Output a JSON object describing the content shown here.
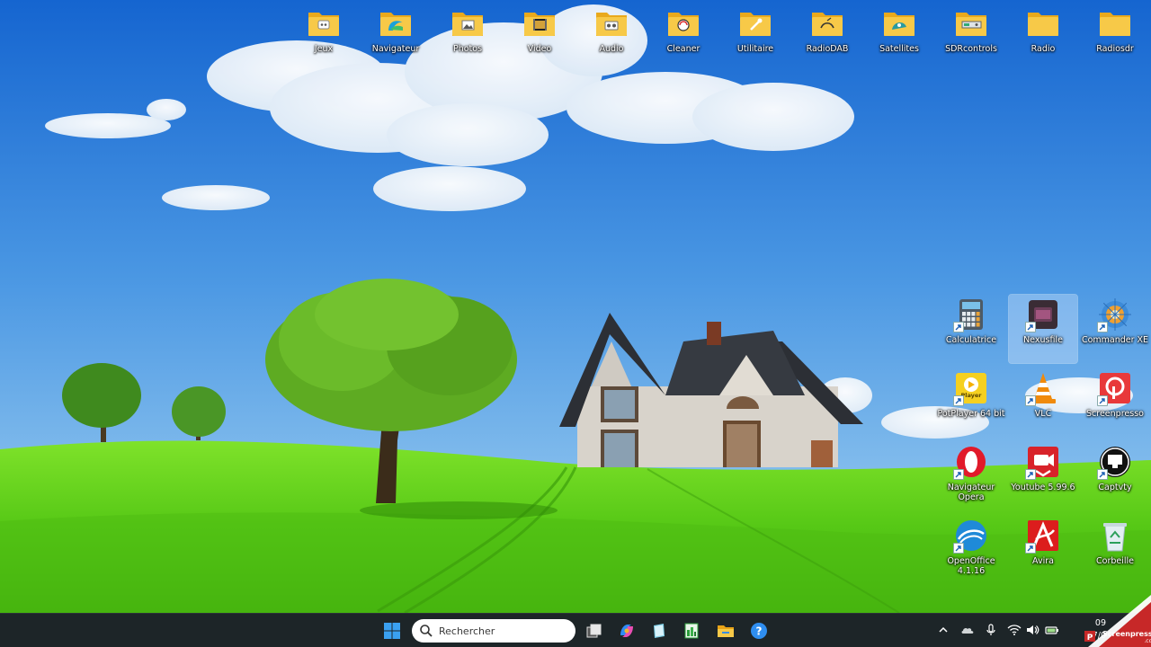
{
  "desktop": {
    "top_row": [
      {
        "name": "jeux",
        "label": "Jeux",
        "icon": "folder-games-icon"
      },
      {
        "name": "navigateur",
        "label": "Navigateur",
        "icon": "folder-browser-icon"
      },
      {
        "name": "photos",
        "label": "Photos",
        "icon": "folder-photos-icon"
      },
      {
        "name": "video",
        "label": "Video",
        "icon": "folder-video-icon"
      },
      {
        "name": "audio",
        "label": "Audio",
        "icon": "folder-audio-icon"
      },
      {
        "name": "cleaner",
        "label": "Cleaner",
        "icon": "folder-cleaner-icon"
      },
      {
        "name": "utilitaire",
        "label": "Utilitaire",
        "icon": "folder-utility-icon"
      },
      {
        "name": "radiodab",
        "label": "RadioDAB",
        "icon": "folder-radio-dab-icon"
      },
      {
        "name": "satellites",
        "label": "Satellites",
        "icon": "folder-satellites-icon"
      },
      {
        "name": "sdrcontrols",
        "label": "SDRcontrols",
        "icon": "folder-sdr-icon"
      },
      {
        "name": "radio",
        "label": "Radio",
        "icon": "folder-icon"
      },
      {
        "name": "radiosdr",
        "label": "Radiosdr",
        "icon": "folder-icon"
      }
    ],
    "right_grid": [
      {
        "name": "calculatrice",
        "label": "Calculatrice",
        "icon": "calculator-icon"
      },
      {
        "name": "nexusfile",
        "label": "Nexusfile",
        "icon": "nexusfile-icon"
      },
      {
        "name": "commander-xe",
        "label": "Commander XE",
        "icon": "commander-xe-icon"
      },
      {
        "name": "potplayer",
        "label": "PotPlayer 64 bit",
        "icon": "potplayer-icon",
        "badge": "Player"
      },
      {
        "name": "vlc",
        "label": "VLC",
        "icon": "vlc-cone-icon"
      },
      {
        "name": "screenpresso",
        "label": "Screenpresso",
        "icon": "screenpresso-icon"
      },
      {
        "name": "navigateur-opera",
        "label": "Navigateur Opera",
        "icon": "opera-icon"
      },
      {
        "name": "youtube",
        "label": "Youtube 5.99.6",
        "icon": "youtube-downloader-icon"
      },
      {
        "name": "captvty",
        "label": "Captvty",
        "icon": "captvty-icon"
      },
      {
        "name": "openoffice",
        "label": "OpenOffice 4.1.16",
        "icon": "openoffice-icon"
      },
      {
        "name": "avira",
        "label": "Avira",
        "icon": "avira-icon"
      },
      {
        "name": "corbeille",
        "label": "Corbeille",
        "icon": "recycle-bin-icon"
      }
    ]
  },
  "taskbar": {
    "search_placeholder": "Rechercher",
    "pinned": [
      {
        "name": "start",
        "icon": "windows-start-icon"
      },
      {
        "name": "task-view",
        "icon": "task-view-icon"
      },
      {
        "name": "copilot",
        "icon": "copilot-icon"
      },
      {
        "name": "notepad",
        "icon": "notepad-icon"
      },
      {
        "name": "spreadsheet",
        "icon": "spreadsheet-icon"
      },
      {
        "name": "file-explorer",
        "icon": "file-explorer-icon"
      },
      {
        "name": "help",
        "icon": "help-icon"
      }
    ],
    "tray": [
      "chevron-up-icon",
      "onedrive-cloud-icon",
      "microphone-icon",
      "wifi-icon",
      "speaker-icon",
      "battery-icon"
    ],
    "clock_time": "09",
    "clock_date": "17/0"
  },
  "watermark": {
    "brand": "Screenpresso",
    "domain": ".com"
  },
  "colors": {
    "sky_top": "#1a6fd6",
    "sky_bottom": "#8cc4ef",
    "grass": "#5fcf1c",
    "taskbar": "#1d2528",
    "folder_yellow": "#f7c948"
  }
}
